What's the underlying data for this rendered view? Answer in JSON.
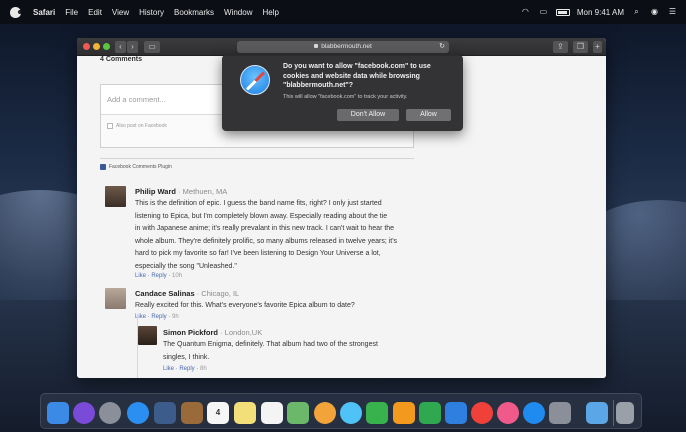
{
  "menubar": {
    "app": "Safari",
    "menus": [
      "File",
      "Edit",
      "View",
      "History",
      "Bookmarks",
      "Window",
      "Help"
    ],
    "clock": "Mon 9:41 AM",
    "status_icons": [
      "wifi-icon",
      "airplay-icon",
      "battery-icon",
      "search-icon",
      "siri-icon",
      "menu-list-icon"
    ]
  },
  "toolbar": {
    "address": "blabbermouth.net"
  },
  "page": {
    "comments_count": "4 Comments",
    "comment_placeholder": "Add a comment...",
    "also_post": "Also post on Facebook",
    "plugin": "Facebook Comments Plugin"
  },
  "comments": [
    {
      "name": "Philip Ward",
      "location": " · Methuen, MA",
      "lines": [
        "This is the definition of epic. I guess the band name fits, right? I only just started",
        "listening to Epica, but I'm completely blown away. Especially reading about the tie",
        "in with Japanese anime; it's really prevalant in this new track. I can't wait to hear the",
        "whole album. They're definitely prolific, so many albums released in twelve years; it's",
        "hard to pick my favorite so far! I've been listening to Design Your Universe a lot,",
        "especially the song \"Unleashed.\""
      ],
      "actions": "Like · Reply · ",
      "time": "10h"
    },
    {
      "name": "Candace Salinas",
      "location": " · Chicago, IL",
      "lines": [
        "Really excited for this. What's everyone's favorite Epica album to date?"
      ],
      "actions": "Like · Reply · ",
      "time": "9h"
    },
    {
      "name": "Simon Pickford",
      "location": " · London,UK",
      "lines": [
        "The Quantum Enigma, definitely. That album had two of the strongest",
        "singles, I think."
      ],
      "actions": "Like · Reply · ",
      "time": "8h"
    }
  ],
  "dialog": {
    "title": "Do you want to allow \"facebook.com\" to use cookies and website data while browsing \"blabbermouth.net\"?",
    "subtitle": "This will allow \"facebook.com\" to track your activity.",
    "deny_label": "Don't Allow",
    "allow_label": "Allow"
  },
  "dock": {
    "items": [
      {
        "name": "finder-icon",
        "color": "#3b8be6"
      },
      {
        "name": "siri-icon",
        "color": "#7a4ad8"
      },
      {
        "name": "launchpad-icon",
        "color": "#8a8f99"
      },
      {
        "name": "safari-icon",
        "color": "#2a8ff0"
      },
      {
        "name": "photo-booth-icon",
        "color": "#3c5d8c"
      },
      {
        "name": "notebook-icon",
        "color": "#9a6a3a"
      },
      {
        "name": "calendar-icon",
        "color": "#f6f6f6"
      },
      {
        "name": "notes-icon",
        "color": "#f3df7a"
      },
      {
        "name": "reminders-icon",
        "color": "#f4f4f4"
      },
      {
        "name": "maps-icon",
        "color": "#6cb86a"
      },
      {
        "name": "photos-icon",
        "color": "#f2a43a"
      },
      {
        "name": "messages-icon",
        "color": "#4fc3f7"
      },
      {
        "name": "facetime-icon",
        "color": "#37b24d"
      },
      {
        "name": "pages-icon",
        "color": "#f39a1e"
      },
      {
        "name": "numbers-icon",
        "color": "#2fa84f"
      },
      {
        "name": "keynote-icon",
        "color": "#2f7fe0"
      },
      {
        "name": "news-icon",
        "color": "#f0403a"
      },
      {
        "name": "itunes-icon",
        "color": "#f05a8a"
      },
      {
        "name": "app-store-icon",
        "color": "#1f8af0"
      },
      {
        "name": "system-preferences-icon",
        "color": "#8a8f99"
      },
      {
        "name": "downloads-folder-icon",
        "color": "#5aa6e6"
      },
      {
        "name": "trash-icon",
        "color": "#9aa0a8"
      }
    ],
    "calendar_day": "4"
  }
}
